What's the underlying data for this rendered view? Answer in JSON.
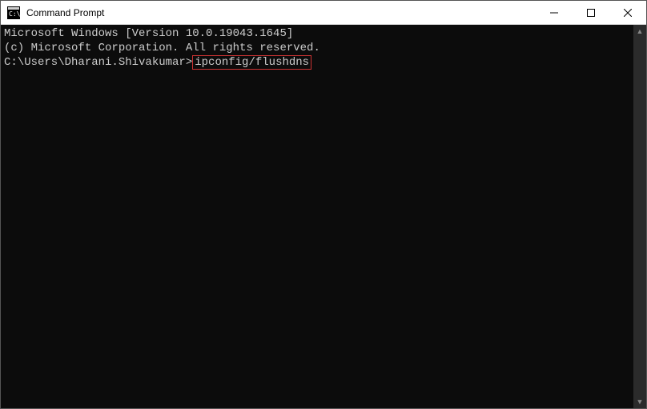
{
  "window": {
    "title": "Command Prompt",
    "icon_name": "cmd-icon"
  },
  "terminal": {
    "line1": "Microsoft Windows [Version 10.0.19043.1645]",
    "line2": "(c) Microsoft Corporation. All rights reserved.",
    "blank": "",
    "prompt": "C:\\Users\\Dharani.Shivakumar>",
    "command": "ipconfig/flushdns"
  },
  "colors": {
    "terminal_bg": "#0c0c0c",
    "terminal_fg": "#cccccc",
    "highlight_border": "#cc3333"
  }
}
